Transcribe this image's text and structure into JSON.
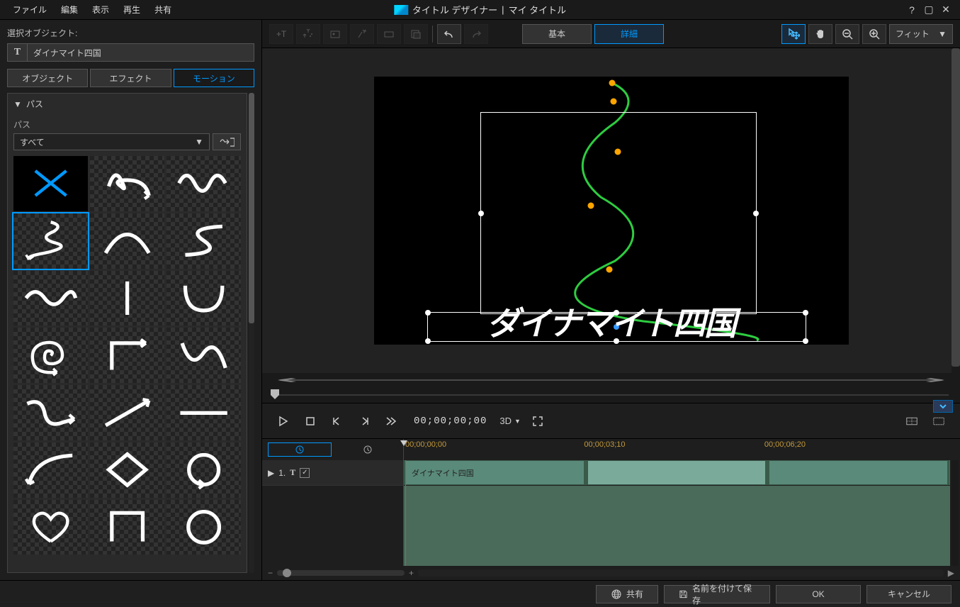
{
  "menu": {
    "file": "ファイル",
    "edit": "編集",
    "view": "表示",
    "play": "再生",
    "share": "共有"
  },
  "app_title": "タイトル デザイナー",
  "title_sep": "|",
  "doc_title": "マイ タイトル",
  "left": {
    "selected_label": "選択オブジェクト:",
    "object_name": "ダイナマイト四国",
    "tabs": {
      "object": "オブジェクト",
      "effect": "エフェクト",
      "motion": "モーション"
    },
    "section_path": "パス",
    "path_sub": "パス",
    "filter_all": "すべて"
  },
  "toolbar": {
    "basic": "基本",
    "detail": "詳細",
    "fit": "フィット"
  },
  "preview_text": "ダイナマイト四国",
  "playback": {
    "timecode": "00;00;00;00",
    "btn3d": "3D"
  },
  "timeline": {
    "ruler": {
      "t0": "00;00;00;00",
      "t1": "00;00;03;10",
      "t2": "00;00;06;20"
    },
    "track_num": "1.",
    "clip_label": "ダイナマイト四国"
  },
  "footer": {
    "share": "共有",
    "save_as": "名前を付けて保存",
    "ok": "OK",
    "cancel": "キャンセル"
  }
}
